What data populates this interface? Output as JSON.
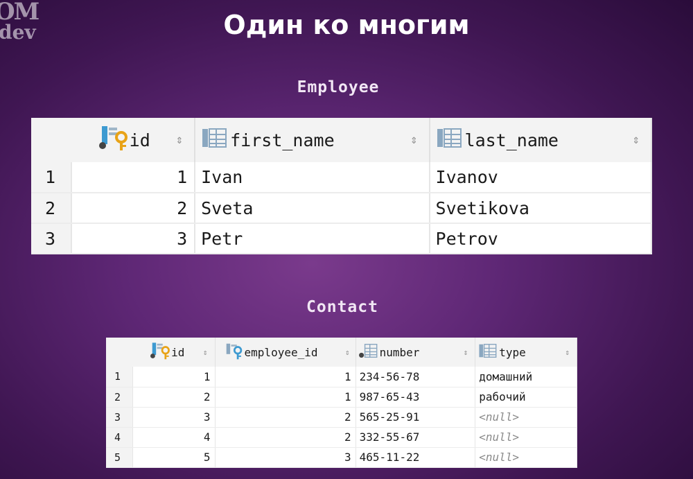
{
  "logo": {
    "line1": "OM",
    "line2": "dev"
  },
  "title": "Один ко многим",
  "employee": {
    "caption": "Employee",
    "columns": [
      "id",
      "first_name",
      "last_name"
    ],
    "rows": [
      {
        "n": "1",
        "id": "1",
        "first_name": "Ivan",
        "last_name": "Ivanov"
      },
      {
        "n": "2",
        "id": "2",
        "first_name": "Sveta",
        "last_name": "Svetikova"
      },
      {
        "n": "3",
        "id": "3",
        "first_name": "Petr",
        "last_name": "Petrov"
      }
    ]
  },
  "contact": {
    "caption": "Contact",
    "columns": [
      "id",
      "employee_id",
      "number",
      "type"
    ],
    "rows": [
      {
        "n": "1",
        "id": "1",
        "employee_id": "1",
        "number": "234-56-78",
        "type": "домашний"
      },
      {
        "n": "2",
        "id": "2",
        "employee_id": "1",
        "number": "987-65-43",
        "type": "рабочий"
      },
      {
        "n": "3",
        "id": "3",
        "employee_id": "2",
        "number": "565-25-91",
        "type": "<null>"
      },
      {
        "n": "4",
        "id": "4",
        "employee_id": "2",
        "number": "332-55-67",
        "type": "<null>"
      },
      {
        "n": "5",
        "id": "5",
        "employee_id": "3",
        "number": "465-11-22",
        "type": "<null>"
      }
    ]
  },
  "sort_glyph": "⇕",
  "icons": {
    "primary_key": "key-column-icon",
    "foreign_key": "foreign-key-column-icon",
    "column": "column-icon"
  },
  "colors": {
    "key_gold": "#e8a317",
    "fk_blue": "#3d9ad1",
    "column_blue": "#5b8db8"
  }
}
